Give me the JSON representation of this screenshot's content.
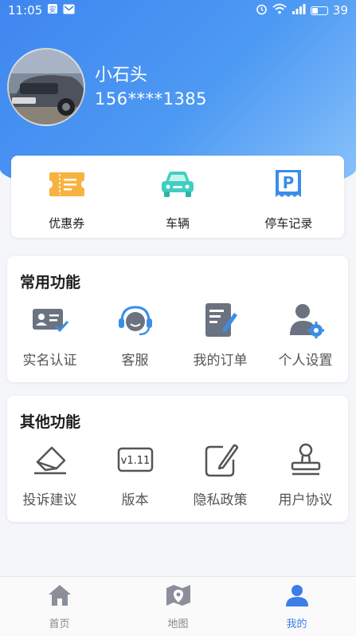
{
  "status_bar": {
    "time": "11:05",
    "battery": "39"
  },
  "profile": {
    "name": "小石头",
    "phone": "156****1385"
  },
  "quick_actions": [
    {
      "label": "优惠券",
      "icon": "ticket-icon"
    },
    {
      "label": "车辆",
      "icon": "car-icon"
    },
    {
      "label": "停车记录",
      "icon": "parking-receipt-icon"
    }
  ],
  "common_functions": {
    "title": "常用功能",
    "items": [
      {
        "label": "实名认证",
        "icon": "id-card-icon"
      },
      {
        "label": "客服",
        "icon": "headset-icon"
      },
      {
        "label": "我的订单",
        "icon": "order-icon"
      },
      {
        "label": "个人设置",
        "icon": "user-settings-icon"
      }
    ]
  },
  "other_functions": {
    "title": "其他功能",
    "items": [
      {
        "label": "投诉建议",
        "icon": "eraser-icon"
      },
      {
        "label": "版本",
        "icon": "version-icon",
        "badge": "v1.11"
      },
      {
        "label": "隐私政策",
        "icon": "edit-icon"
      },
      {
        "label": "用户协议",
        "icon": "stamp-icon"
      }
    ]
  },
  "tabbar": {
    "items": [
      {
        "label": "首页",
        "icon": "home-icon"
      },
      {
        "label": "地图",
        "icon": "map-icon"
      },
      {
        "label": "我的",
        "icon": "profile-icon",
        "active": true
      }
    ]
  },
  "colors": {
    "accent": "#3d7de8",
    "orange": "#f5a623",
    "teal": "#3fcfc2",
    "blue": "#3a8ee8",
    "gray_icon": "#6b7280"
  }
}
